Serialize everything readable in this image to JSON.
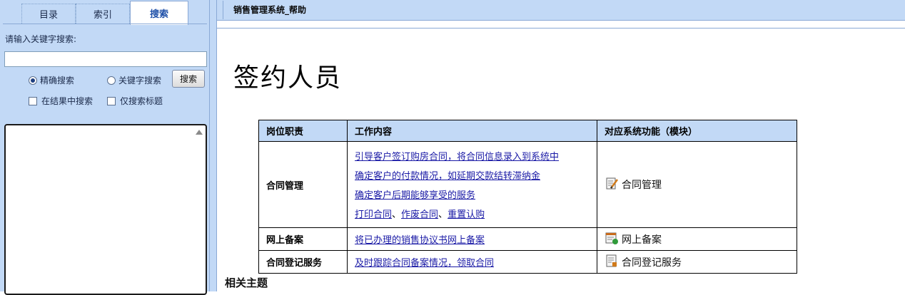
{
  "left_pane": {
    "tabs": [
      "目录",
      "索引",
      "搜索"
    ],
    "active_tab": "搜索",
    "search_prompt": "请输入关键字搜索:",
    "search_value": "",
    "options": {
      "exact": {
        "label": "精确搜索",
        "checked": true
      },
      "keyword": {
        "label": "关键字搜索",
        "checked": false
      },
      "in_results": {
        "label": "在结果中搜索",
        "checked": false
      },
      "title_only": {
        "label": "仅搜索标题",
        "checked": false
      }
    },
    "search_button": "搜索"
  },
  "header": {
    "title": "销售管理系统_帮助"
  },
  "page": {
    "title": "签约人员",
    "table": {
      "headers": [
        "岗位职责",
        "工作内容",
        "对应系统功能（模块）"
      ],
      "rows": [
        {
          "role": "合同管理",
          "tasks": [
            {
              "parts": [
                "引导客户签订购房合同，将合同信息录入到系统中"
              ]
            },
            {
              "parts": [
                "确定客户的付款情况，如延期交款结转滞纳金"
              ]
            },
            {
              "parts": [
                "确定客户后期能够享受的服务"
              ]
            },
            {
              "parts": [
                "打印合同",
                "作废合同",
                "重置认购"
              ],
              "separator": "、"
            }
          ],
          "function": {
            "icon": "contract-edit-icon",
            "label": "合同管理"
          }
        },
        {
          "role": "网上备案",
          "tasks": [
            {
              "parts": [
                "将已办理的销售协议书网上备案"
              ]
            }
          ],
          "function": {
            "icon": "online-filing-icon",
            "label": "网上备案"
          }
        },
        {
          "role": "合同登记服务",
          "tasks": [
            {
              "parts": [
                "及时跟踪合同备案情况，领取合同"
              ]
            }
          ],
          "function": {
            "icon": "contract-register-icon",
            "label": "合同登记服务"
          }
        }
      ]
    },
    "related_topics": "相关主题"
  },
  "colors": {
    "pane_bg": "#c2d9f6",
    "link": "#1a1aa6",
    "active_tab_text": "#1d4fa8"
  }
}
